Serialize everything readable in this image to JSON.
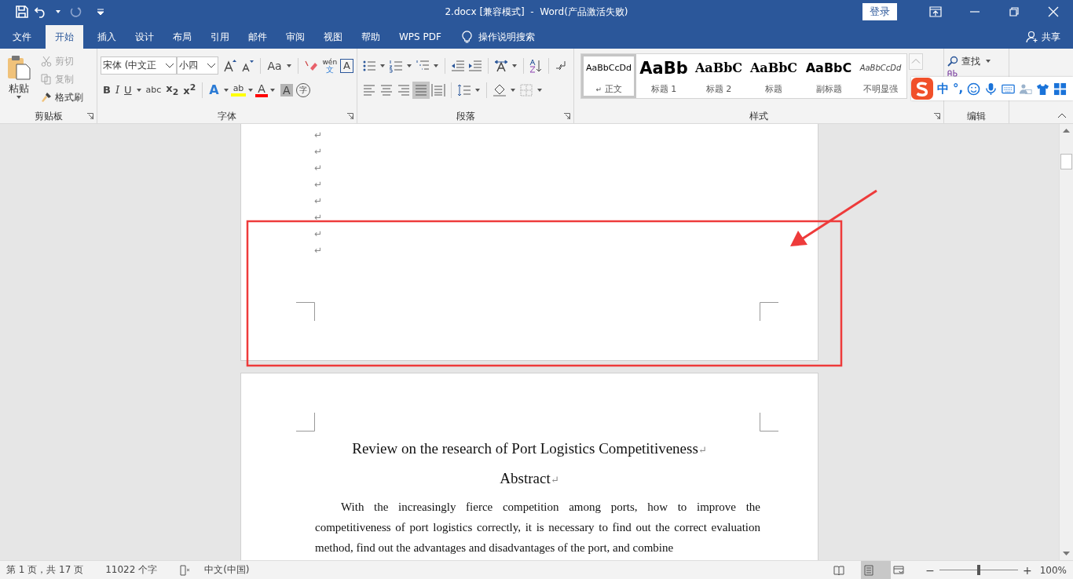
{
  "window": {
    "title": "2.docx [兼容模式]  -  Word(产品激活失败)",
    "login_button": "登录"
  },
  "tabs": [
    {
      "label": "文件",
      "selected": false
    },
    {
      "label": "开始",
      "selected": true
    },
    {
      "label": "插入",
      "selected": false
    },
    {
      "label": "设计",
      "selected": false
    },
    {
      "label": "布局",
      "selected": false
    },
    {
      "label": "引用",
      "selected": false
    },
    {
      "label": "邮件",
      "selected": false
    },
    {
      "label": "审阅",
      "selected": false
    },
    {
      "label": "视图",
      "selected": false
    },
    {
      "label": "帮助",
      "selected": false
    },
    {
      "label": "WPS PDF",
      "selected": false
    }
  ],
  "tell_me": "操作说明搜索",
  "share": "共享",
  "ribbon": {
    "clipboard": {
      "label": "剪贴板",
      "paste": "粘贴",
      "commands": [
        {
          "kind": "cut",
          "label": "剪切",
          "disabled": true
        },
        {
          "kind": "copy",
          "label": "复制",
          "disabled": true
        },
        {
          "kind": "painter",
          "label": "格式刷",
          "disabled": false
        }
      ]
    },
    "font": {
      "label": "字体",
      "font_name": "宋体 (中文正",
      "font_size": "小四",
      "case_button": "Aa",
      "phonetic": [
        "wén",
        "文"
      ],
      "border_glyph": "A",
      "format_buttons": [
        {
          "kind": "bold",
          "glyph": "B"
        },
        {
          "kind": "italic",
          "glyph": "I"
        },
        {
          "kind": "underline",
          "glyph": "U"
        },
        {
          "kind": "strike",
          "glyph": "abc"
        },
        {
          "kind": "sub",
          "glyph": "x$_{2}$"
        },
        {
          "kind": "sup",
          "glyph": "x$^{2}$"
        }
      ],
      "effect_buttons": [
        {
          "kind": "effects",
          "glyph": "A"
        },
        {
          "kind": "highlight",
          "glyph": "ab"
        },
        {
          "kind": "color",
          "glyph": "A"
        },
        {
          "kind": "shading",
          "glyph": "A"
        },
        {
          "kind": "enclosed",
          "glyph": "字"
        }
      ]
    },
    "paragraph": {
      "label": "段落",
      "alignments": [
        {
          "selected": false
        },
        {
          "selected": false
        },
        {
          "selected": false
        },
        {
          "selected": true
        },
        {
          "selected": false
        }
      ]
    },
    "styles": {
      "label": "样式",
      "items": [
        {
          "kind": "normal",
          "sample": "AaBbCcDd",
          "mark": "↵",
          "name": "正文",
          "selected": true
        },
        {
          "kind": "heading1",
          "sample": "AaBb",
          "name": "标题 1",
          "selected": false
        },
        {
          "kind": "heading2",
          "sample": "AaBbC",
          "name": "标题 2",
          "selected": false
        },
        {
          "kind": "title",
          "sample": "AaBbC",
          "name": "标题",
          "selected": false
        },
        {
          "kind": "subtitle",
          "sample": "AaBbC",
          "name": "副标题",
          "selected": false
        },
        {
          "kind": "emphasis",
          "sample": "AaBbCcDd",
          "name": "不明显强",
          "selected": false
        }
      ]
    },
    "editing": {
      "label": "编辑",
      "find": "查找"
    }
  },
  "ime_toolbar": {
    "mode": "中",
    "punctuation": "°,"
  },
  "document": {
    "page1_marks": [
      "↵",
      "↵",
      "↵",
      "↵",
      "↵",
      "↵",
      "↵",
      "↵"
    ],
    "title": "Review on the research of Port Logistics Competitiveness",
    "heading_mark": "↵",
    "abstract": "Abstract",
    "body": "With the increasingly fierce competition among ports, how to improve the competitiveness of port logistics correctly, it is necessary to find out the correct evaluation method, find out the advantages and disadvantages of the port, and combine"
  },
  "status_bar": {
    "page": "第 1 页，共 17 页",
    "words": "11022 个字",
    "language": "中文(中国)",
    "zoom": "100%",
    "zoom_out": "−",
    "zoom_in": "+",
    "zoom_slider": {
      "level": 0.5
    },
    "view_modes": [
      {
        "kind": "read",
        "selected": false
      },
      {
        "kind": "print",
        "selected": true
      },
      {
        "kind": "web",
        "selected": false
      }
    ]
  }
}
